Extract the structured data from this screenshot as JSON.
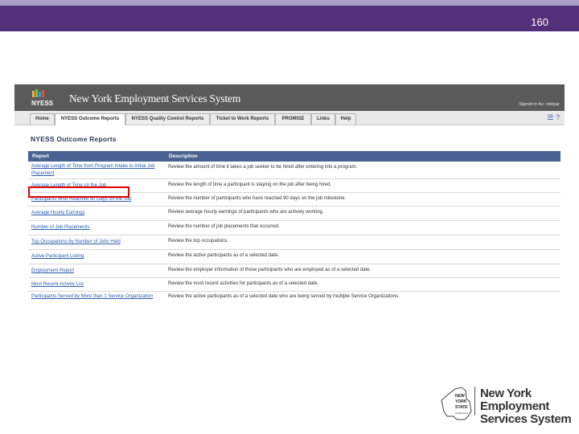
{
  "slide": {
    "number": "160"
  },
  "app": {
    "logo_text": "NYESS",
    "title": "New York Employment Services System",
    "signed_in": "Signed in As: ndepar"
  },
  "tabs": [
    {
      "label": "Home",
      "active": false
    },
    {
      "label": "NYESS Outcome Reports",
      "active": true
    },
    {
      "label": "NYESS Quality Control Reports",
      "active": false
    },
    {
      "label": "Ticket to Work Reports",
      "active": false
    },
    {
      "label": "PROMISE",
      "active": false
    },
    {
      "label": "Links",
      "active": false
    },
    {
      "label": "Help",
      "active": false
    }
  ],
  "page_title": "NYESS Outcome Reports",
  "table": {
    "headers": [
      "Report",
      "Description"
    ],
    "rows": [
      {
        "report": "Average Length of Time from Program Intake to Initial Job Placement",
        "description": "Review the amount of time it takes a job seeker to be hired after entering into a program."
      },
      {
        "report": "Average Length of Time on the Job",
        "description": "Review the length of time a participant is staying on the job after being hired.",
        "highlighted": true
      },
      {
        "report": "Participants Who Reached 90 Days on the Job",
        "description": "Review the number of participants who have reached 90 days on the job milestone."
      },
      {
        "report": "Average Hourly Earnings",
        "description": "Review average hourly earnings of participants who are actively working."
      },
      {
        "report": "Number of Job Placements",
        "description": "Review the number of job placements that occurred."
      },
      {
        "report": "Top Occupations by Number of Jobs Held",
        "description": "Review the top occupations."
      },
      {
        "report": "Active Participant Listing",
        "description": "Review the active participants as of a selected date."
      },
      {
        "report": "Employment Report",
        "description": "Review the employer information of those participants who are employed as of a selected date."
      },
      {
        "report": "Most Recent Activity List",
        "description": "Review the most recent activities for participants as of a selected date."
      },
      {
        "report": "Participants Served by More than 1 Service Organization",
        "description": "Review the active participants as of a selected date who are being served by multiple Service Organizations."
      }
    ]
  },
  "footer_logo": {
    "state_lines": [
      "NEW",
      "YORK",
      "STATE"
    ],
    "state_small": "of Opportunity",
    "line1": "New York Employment",
    "line2": "Services System"
  },
  "colors": {
    "slide_bar": "#55307a",
    "table_header": "#4a6291",
    "link": "#2b5cae",
    "highlight": "#e00000"
  }
}
